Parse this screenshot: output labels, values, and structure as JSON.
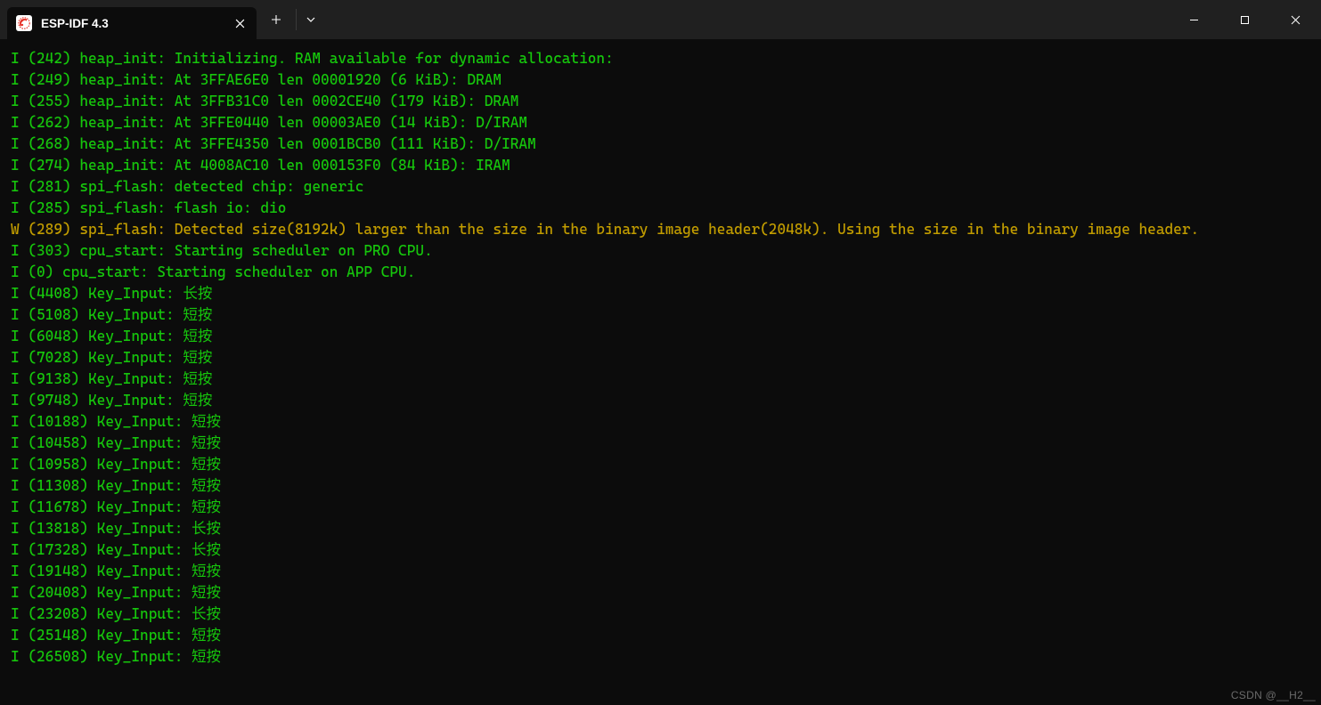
{
  "window": {
    "tab_title": "ESP-IDF 4.3"
  },
  "log_lines": [
    {
      "level": "I",
      "text": "I (242) heap_init: Initializing. RAM available for dynamic allocation:"
    },
    {
      "level": "I",
      "text": "I (249) heap_init: At 3FFAE6E0 len 00001920 (6 KiB): DRAM"
    },
    {
      "level": "I",
      "text": "I (255) heap_init: At 3FFB31C0 len 0002CE40 (179 KiB): DRAM"
    },
    {
      "level": "I",
      "text": "I (262) heap_init: At 3FFE0440 len 00003AE0 (14 KiB): D/IRAM"
    },
    {
      "level": "I",
      "text": "I (268) heap_init: At 3FFE4350 len 0001BCB0 (111 KiB): D/IRAM"
    },
    {
      "level": "I",
      "text": "I (274) heap_init: At 4008AC10 len 000153F0 (84 KiB): IRAM"
    },
    {
      "level": "I",
      "text": "I (281) spi_flash: detected chip: generic"
    },
    {
      "level": "I",
      "text": "I (285) spi_flash: flash io: dio"
    },
    {
      "level": "W",
      "text": "W (289) spi_flash: Detected size(8192k) larger than the size in the binary image header(2048k). Using the size in the binary image header."
    },
    {
      "level": "I",
      "text": "I (303) cpu_start: Starting scheduler on PRO CPU."
    },
    {
      "level": "I",
      "text": "I (0) cpu_start: Starting scheduler on APP CPU."
    },
    {
      "level": "I",
      "text": "I (4408) Key_Input: 长按"
    },
    {
      "level": "I",
      "text": "I (5108) Key_Input: 短按"
    },
    {
      "level": "I",
      "text": "I (6048) Key_Input: 短按"
    },
    {
      "level": "I",
      "text": "I (7028) Key_Input: 短按"
    },
    {
      "level": "I",
      "text": "I (9138) Key_Input: 短按"
    },
    {
      "level": "I",
      "text": "I (9748) Key_Input: 短按"
    },
    {
      "level": "I",
      "text": "I (10188) Key_Input: 短按"
    },
    {
      "level": "I",
      "text": "I (10458) Key_Input: 短按"
    },
    {
      "level": "I",
      "text": "I (10958) Key_Input: 短按"
    },
    {
      "level": "I",
      "text": "I (11308) Key_Input: 短按"
    },
    {
      "level": "I",
      "text": "I (11678) Key_Input: 短按"
    },
    {
      "level": "I",
      "text": "I (13818) Key_Input: 长按"
    },
    {
      "level": "I",
      "text": "I (17328) Key_Input: 长按"
    },
    {
      "level": "I",
      "text": "I (19148) Key_Input: 短按"
    },
    {
      "level": "I",
      "text": "I (20408) Key_Input: 短按"
    },
    {
      "level": "I",
      "text": "I (23208) Key_Input: 长按"
    },
    {
      "level": "I",
      "text": "I (25148) Key_Input: 短按"
    },
    {
      "level": "I",
      "text": "I (26508) Key_Input: 短按"
    }
  ],
  "watermark": "CSDN @__H2__"
}
